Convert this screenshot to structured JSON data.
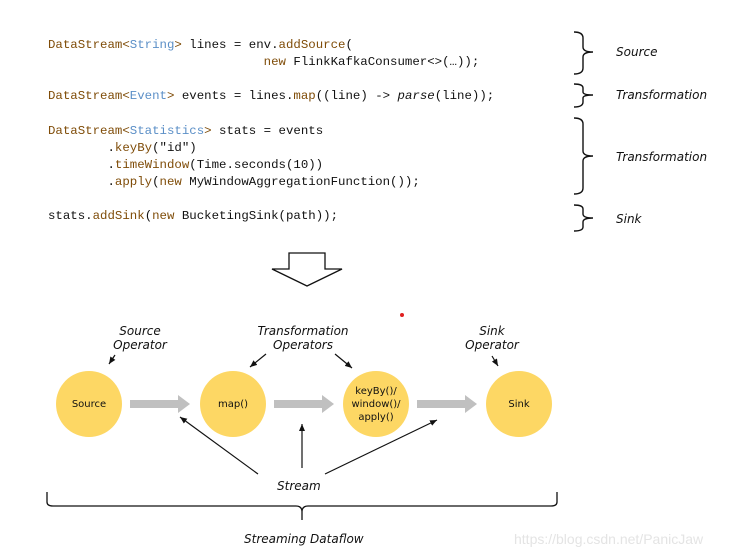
{
  "code": {
    "line1": {
      "a": "DataStream",
      "lt": "<",
      "type": "String",
      "gt": ">",
      "rest": " lines = env.",
      "call": "addSource",
      "tail": "("
    },
    "line2": {
      "indent": "                             ",
      "kw": "new",
      "rest": " FlinkKafkaConsumer<>(…));"
    },
    "line3": {
      "a": "DataStream",
      "lt": "<",
      "type": "Event",
      "gt": ">",
      "rest": " events = lines.",
      "call": "map",
      "mid": "((line) -> ",
      "parse": "parse",
      "tail": "(line));"
    },
    "line4": {
      "a": "DataStream",
      "lt": "<",
      "type": "Statistics",
      "gt": ">",
      "rest": " stats = events"
    },
    "line5": {
      "indent": "        .",
      "call": "keyBy",
      "tail": "(\"id\")"
    },
    "line6": {
      "indent": "        .",
      "call": "timeWindow",
      "tail": "(Time.seconds(10))"
    },
    "line7": {
      "indent": "        .",
      "call": "apply",
      "mid": "(",
      "kw": "new",
      "tail": " MyWindowAggregationFunction());"
    },
    "line8": {
      "a": "stats.",
      "call": "addSink",
      "mid": "(",
      "kw": "new",
      "tail": " BucketingSink(path));"
    }
  },
  "brace_labels": {
    "source": "Source",
    "transformation1": "Transformation",
    "transformation2": "Transformation",
    "sink": "Sink"
  },
  "diagram": {
    "nodes": {
      "source": "Source",
      "map": "map()",
      "window": [
        "keyBy()/",
        "window()/",
        "apply()"
      ],
      "sink": "Sink"
    },
    "callouts": {
      "source_operator": [
        "Source",
        "Operator"
      ],
      "transformation_operators": [
        "Transformation",
        "Operators"
      ],
      "sink_operator": [
        "Sink",
        "Operator"
      ]
    },
    "stream_label": "Stream",
    "dataflow_label": "Streaming Dataflow",
    "node_color": "#fdd764",
    "arrow_color": "#c0c0c0"
  },
  "watermark": "https://blog.csdn.net/PanicJaw"
}
